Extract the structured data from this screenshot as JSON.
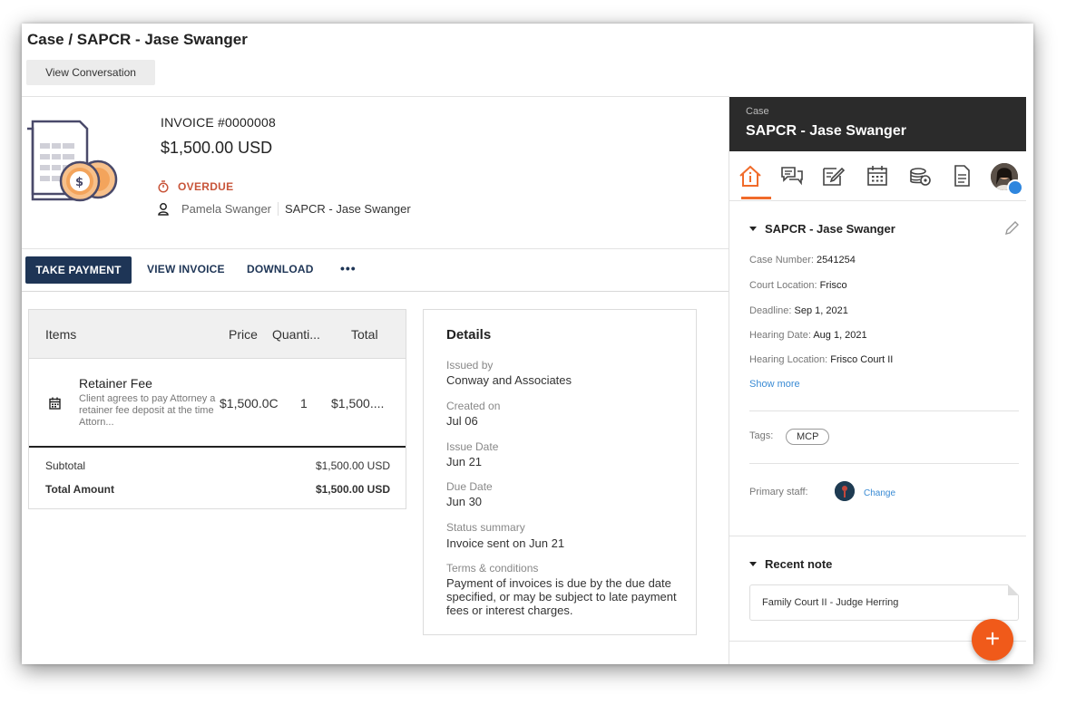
{
  "header": {
    "breadcrumb": "Case / SAPCR - Jase Swanger",
    "view_conversation_label": "View Conversation"
  },
  "invoice": {
    "number": "INVOICE #0000008",
    "amount": "$1,500.00 USD",
    "status": "OVERDUE",
    "status_color": "#c8553a",
    "client_name": "Pamela Swanger",
    "case_name": "SAPCR - Jase Swanger"
  },
  "toolbar": {
    "take_payment_label": "TAKE PAYMENT",
    "view_invoice_label": "VIEW INVOICE",
    "download_label": "DOWNLOAD",
    "more_label": "•••",
    "accent": "#1e3556"
  },
  "items_table": {
    "columns": [
      "Items",
      "Price",
      "Quanti...",
      "Total"
    ],
    "rows": [
      {
        "icon": "calendar-icon",
        "title": "Retainer Fee",
        "description": "Client agrees to pay Attorney a retainer fee deposit at the time Attorn...",
        "price": "$1,500.0C",
        "quantity": "1",
        "total": "$1,500...."
      }
    ],
    "subtotal_label": "Subtotal",
    "subtotal_value": "$1,500.00 USD",
    "total_label": "Total Amount",
    "total_value": "$1,500.00 USD"
  },
  "details": {
    "title": "Details",
    "fields": [
      {
        "label": "Issued by",
        "value": "Conway and Associates"
      },
      {
        "label": "Created on",
        "value": "Jul 06"
      },
      {
        "label": "Issue Date",
        "value": "Jun 21"
      },
      {
        "label": "Due Date",
        "value": "Jun 30"
      },
      {
        "label": "Status summary",
        "value": "Invoice sent on Jun 21"
      },
      {
        "label": "Terms & conditions",
        "value": "Payment of invoices is due by the due date specified, or may be subject to late payment fees or interest charges."
      }
    ]
  },
  "panel": {
    "case_label": "Case",
    "case_title": "SAPCR - Jase Swanger",
    "tabs": [
      "home-info-icon",
      "chat-icon",
      "edit-note-icon",
      "calendar-icon",
      "coins-icon",
      "document-icon",
      "avatar"
    ],
    "active_tab_color": "#f06b2a",
    "section_title": "SAPCR - Jase Swanger",
    "properties": [
      {
        "label": "Case Number:",
        "value": "2541254"
      },
      {
        "label": "Court Location:",
        "value": "Frisco"
      },
      {
        "label": "Deadline:",
        "value": "Sep 1, 2021"
      },
      {
        "label": "Hearing Date:",
        "value": "Aug 1, 2021"
      },
      {
        "label": "Hearing Location:",
        "value": "Frisco Court II"
      }
    ],
    "show_more": "Show more",
    "tags_label": "Tags:",
    "tags": [
      "MCP"
    ],
    "primary_staff_label": "Primary staff:",
    "change_label": "Change",
    "recent_note_title": "Recent note",
    "recent_note": "Family Court II - Judge Herring",
    "fab_label": "+",
    "fab_color": "#f05a1a"
  }
}
